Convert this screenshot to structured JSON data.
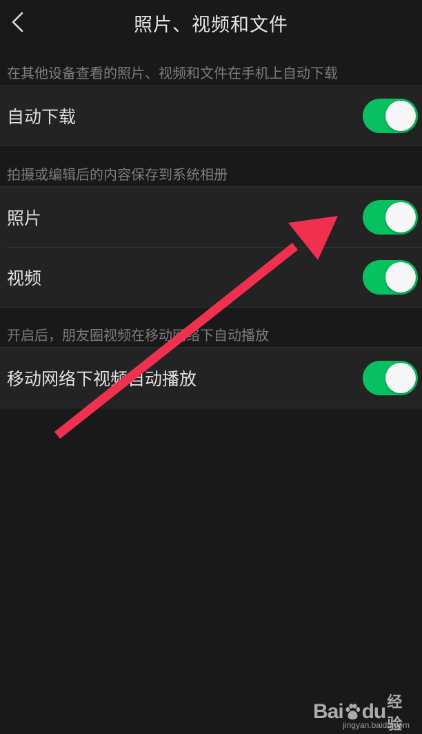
{
  "header": {
    "title": "照片、视频和文件",
    "back_icon": "chevron-left-icon"
  },
  "sections": [
    {
      "caption": "在其他设备查看的照片、视频和文件在手机上自动下载",
      "rows": [
        {
          "label": "自动下载",
          "toggle_on": true
        }
      ]
    },
    {
      "caption": "拍摄或编辑后的内容保存到系统相册",
      "rows": [
        {
          "label": "照片",
          "toggle_on": true
        },
        {
          "label": "视频",
          "toggle_on": true
        }
      ]
    },
    {
      "caption": "开启后，朋友圈视频在移动网络下自动播放",
      "rows": [
        {
          "label": "移动网络下视频自动播放",
          "toggle_on": true
        }
      ]
    }
  ],
  "colors": {
    "background": "#191919",
    "row_background": "#232323",
    "toggle_on": "#07c160",
    "annotation_arrow": "#f0304f"
  },
  "watermark": {
    "brand_left": "Bai",
    "brand_right": "du",
    "brand_suffix": "经验",
    "url": "jingyan.baidu.com"
  }
}
